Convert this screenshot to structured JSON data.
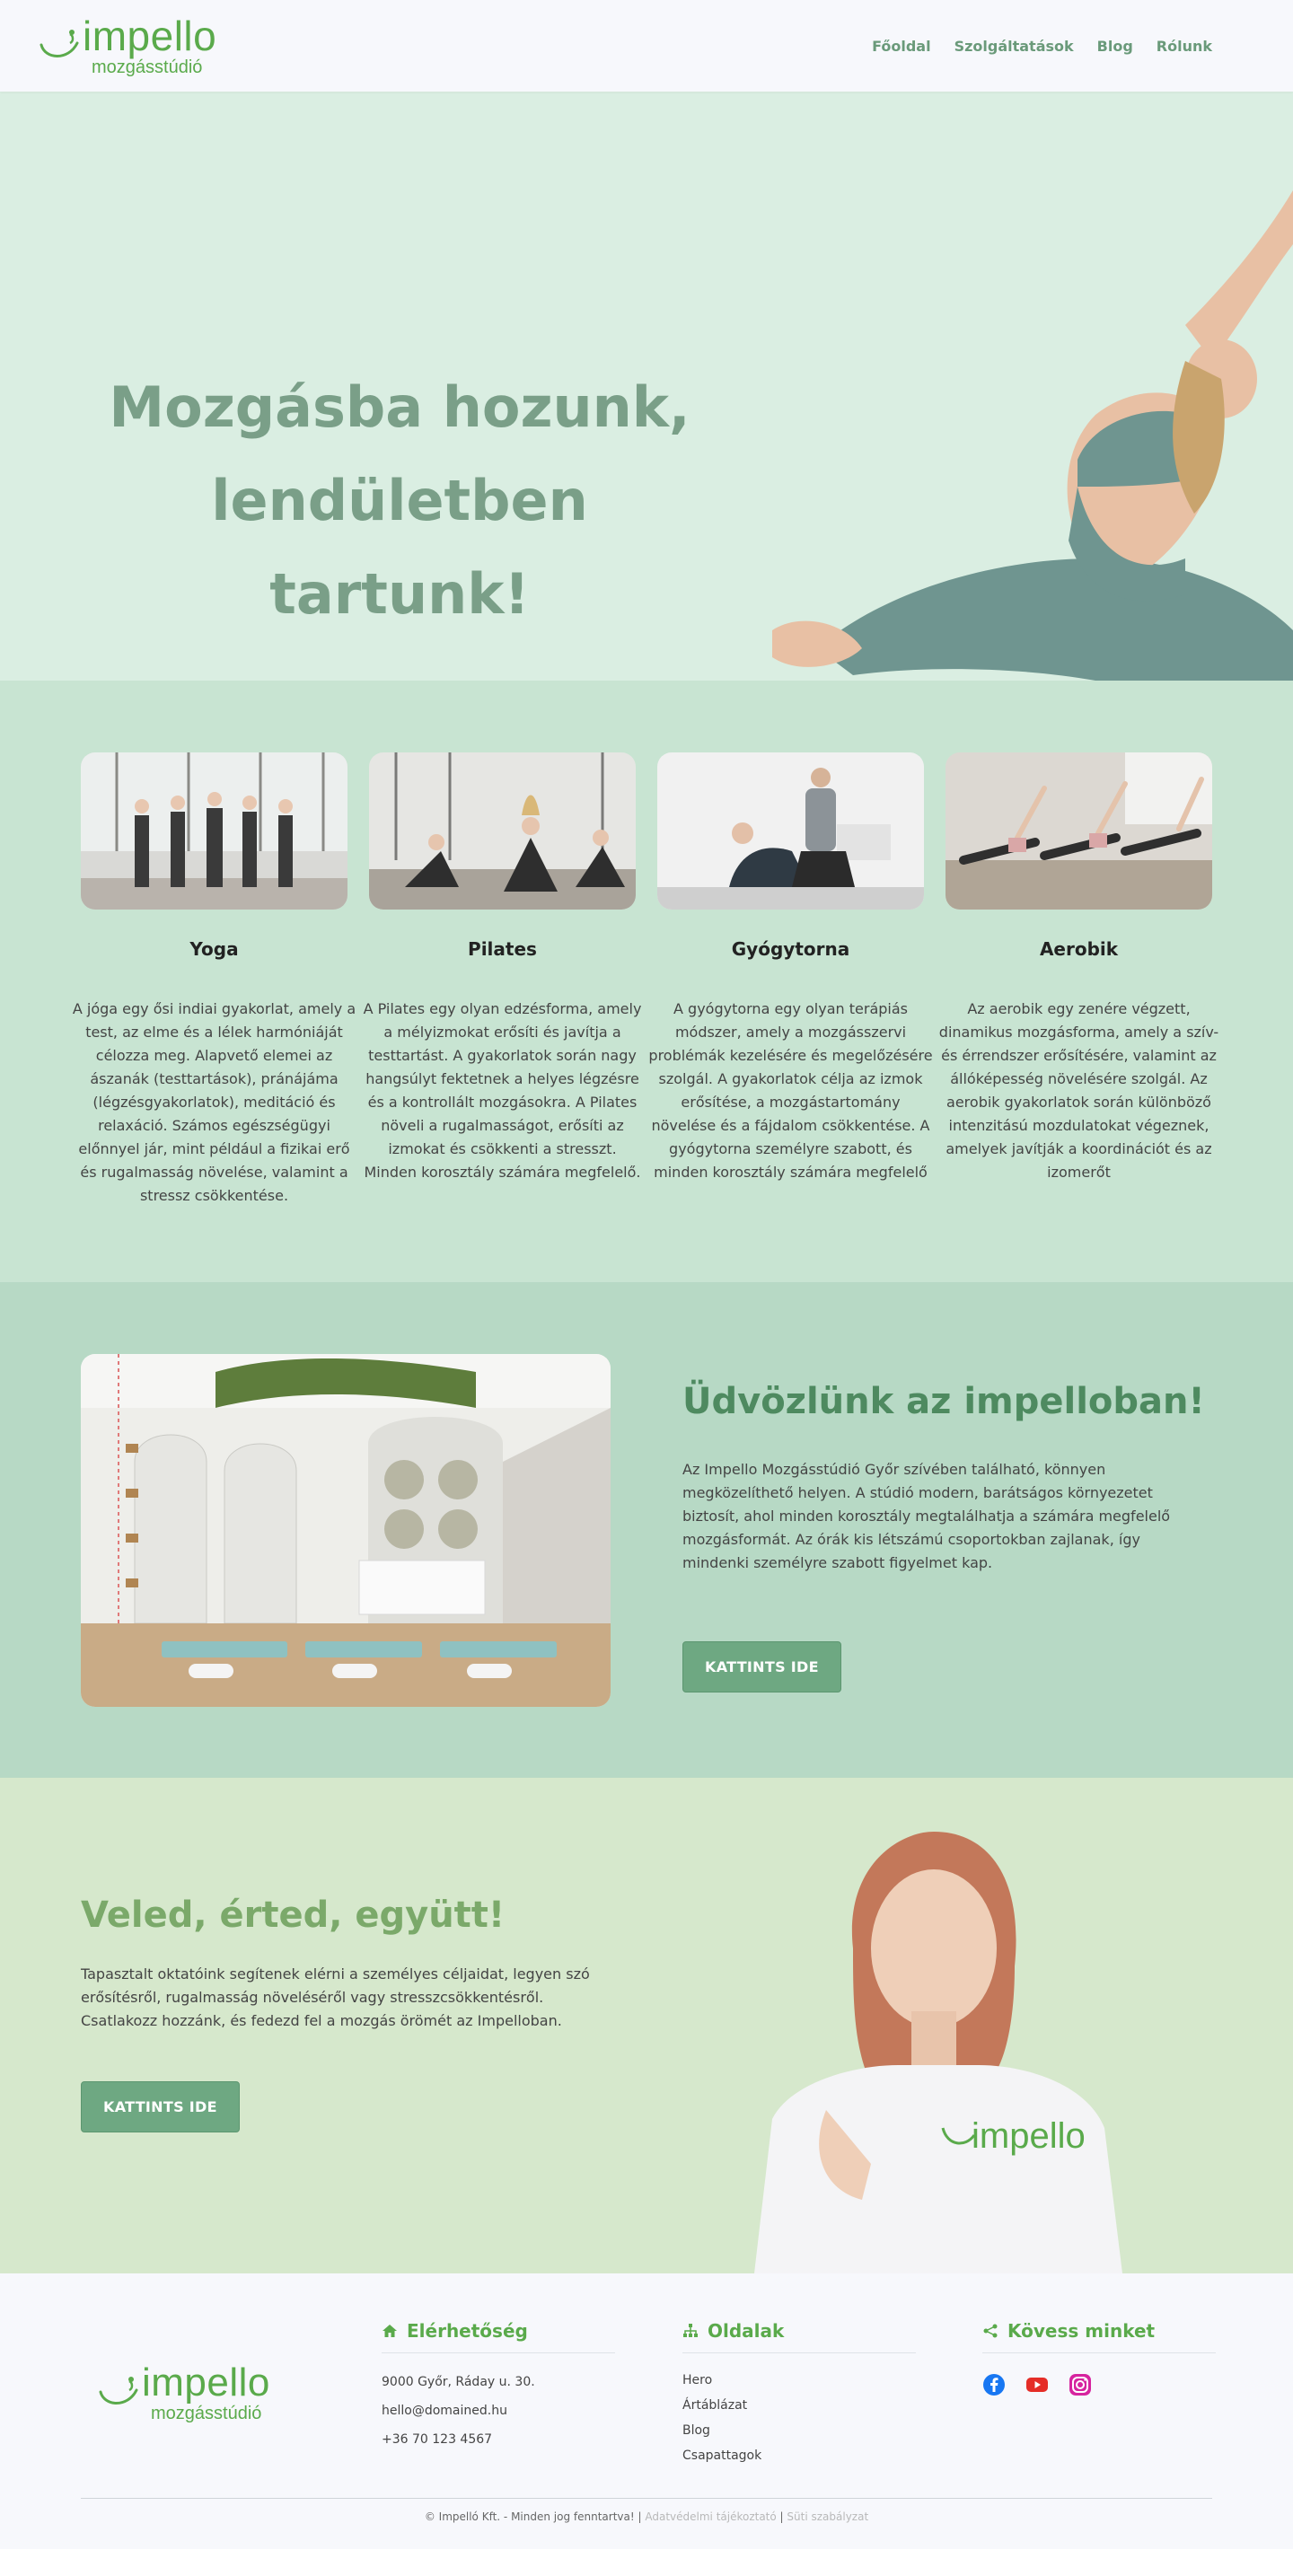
{
  "header": {
    "logo_name": "impello",
    "logo_sub": "mozgásstúdió",
    "nav": [
      "Főoldal",
      "Szolgáltatások",
      "Blog",
      "Rólunk"
    ]
  },
  "hero": {
    "title_line1": "Mozgásba hozunk,",
    "title_line2": "lendületben tartunk!"
  },
  "services": [
    {
      "title": "Yoga",
      "text": "A jóga egy ősi indiai gyakorlat, amely a test, az elme és a lélek harmóniáját célozza meg. Alapvető elemei az ászanák (testtartások), pránájáma (légzésgyakorlatok), meditáció és relaxáció. Számos egészségügyi előnnyel jár, mint például a fizikai erő és rugalmasság növelése, valamint a stressz csökkentése."
    },
    {
      "title": "Pilates",
      "text": "A Pilates egy olyan edzésforma, amely a mélyizmokat erősíti és javítja a testtartást. A gyakorlatok során nagy hangsúlyt fektetnek a helyes légzésre és a kontrollált mozgásokra. A Pilates növeli a rugalmasságot, erősíti az izmokat és csökkenti a stresszt. Minden korosztály számára megfelelő."
    },
    {
      "title": "Gyógytorna",
      "text": "A gyógytorna egy olyan terápiás módszer, amely a mozgásszervi problémák kezelésére és megelőzésére szolgál. A gyakorlatok célja az izmok erősítése, a mozgástartomány növelése és a fájdalom csökkentése. A gyógytorna személyre szabott, és minden korosztály számára megfelelő"
    },
    {
      "title": "Aerobik",
      "text": "Az aerobik egy zenére végzett, dinamikus mozgásforma, amely a szív- és érrendszer erősítésére, valamint az állóképesség növelésére szolgál. Az aerobik gyakorlatok során különböző intenzitású mozdulatokat végeznek, amelyek javítják a koordinációt és az izomerőt"
    }
  ],
  "welcome": {
    "title": "Üdvözlünk az impelloban!",
    "text": "Az Impello Mozgásstúdió Győr szívében található, könnyen megközelíthető helyen. A stúdió modern, barátságos környezetet biztosít, ahol minden korosztály megtalálhatja a számára megfelelő mozgásformát. Az órák kis létszámú csoportokban zajlanak, így mindenki személyre szabott figyelmet kap.",
    "button": "KATTINTS IDE"
  },
  "together": {
    "title": "Veled, érted, együtt!",
    "text": " Tapasztalt oktatóink segítenek elérni a személyes céljaidat, legyen szó erősítésről, rugalmasság növeléséről vagy stresszcsökkentésről. Csatlakozz hozzánk, és fedezd fel a mozgás örömét az Impelloban.",
    "button": "KATTINTS IDE",
    "shirt_logo": "impello"
  },
  "footer": {
    "logo_name": "impello",
    "logo_sub": "mozgásstúdió",
    "contact_title": "Elérhetőség",
    "contact": [
      "9000 Győr, Ráday u. 30.",
      "hello@domained.hu",
      "+36 70 123 4567"
    ],
    "pages_title": "Oldalak",
    "pages": [
      "Hero",
      "Ártáblázat",
      "Blog",
      "Csapattagok"
    ],
    "follow_title": "Kövess minket",
    "copyright": "© Impelló Kft. - Minden jog fenntartva! | ",
    "privacy": "Adatvédelmi tájékoztató",
    "sep": " | ",
    "cookies": "Süti szabályzat"
  },
  "colors": {
    "brand_green": "#5aaa4b",
    "hero_bg": "#daeee2",
    "services_bg": "#c8e4d2",
    "welcome_bg": "#b7d9c5",
    "together_bg": "#d6e8cc",
    "button": "#6ea882"
  },
  "icons": {
    "contact": "home-icon",
    "pages": "sitemap-icon",
    "follow": "share-icon",
    "social": [
      "facebook-icon",
      "youtube-icon",
      "instagram-icon"
    ]
  }
}
